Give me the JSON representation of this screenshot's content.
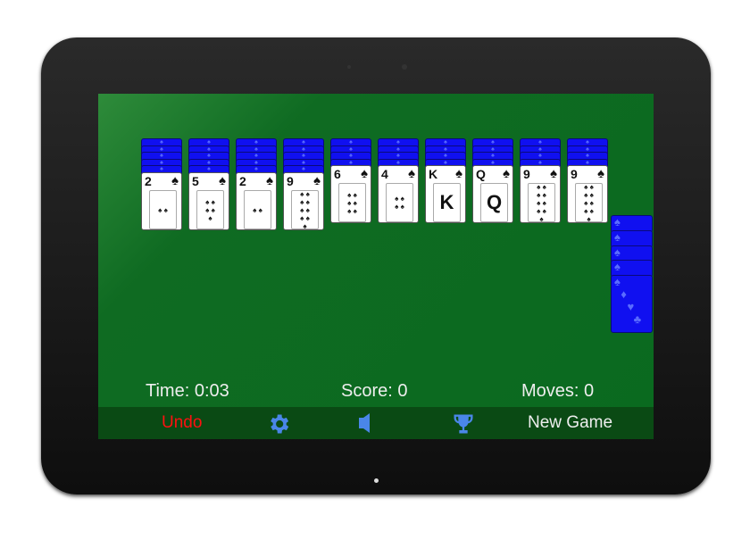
{
  "colors": {
    "felt": "#0a6a1f",
    "card_back": "#1010f0",
    "undo": "#ff0000",
    "icon": "#4a86e8"
  },
  "tableau": [
    {
      "hidden": 5,
      "rank": "2",
      "suit": "♠"
    },
    {
      "hidden": 5,
      "rank": "5",
      "suit": "♠"
    },
    {
      "hidden": 5,
      "rank": "2",
      "suit": "♠"
    },
    {
      "hidden": 5,
      "rank": "9",
      "suit": "♠"
    },
    {
      "hidden": 4,
      "rank": "6",
      "suit": "♠"
    },
    {
      "hidden": 4,
      "rank": "4",
      "suit": "♠"
    },
    {
      "hidden": 4,
      "rank": "K",
      "suit": "♠"
    },
    {
      "hidden": 4,
      "rank": "Q",
      "suit": "♠"
    },
    {
      "hidden": 4,
      "rank": "9",
      "suit": "♠"
    },
    {
      "hidden": 4,
      "rank": "9",
      "suit": "♠"
    }
  ],
  "stock": {
    "piles": 5
  },
  "status": {
    "time": "Time: 0:03",
    "score": "Score: 0",
    "moves": "Moves: 0"
  },
  "toolbar": {
    "undo": "Undo",
    "settings_icon": "gear-icon",
    "sound_icon": "speaker-icon",
    "stats_icon": "trophy-icon",
    "new_game": "New Game"
  }
}
